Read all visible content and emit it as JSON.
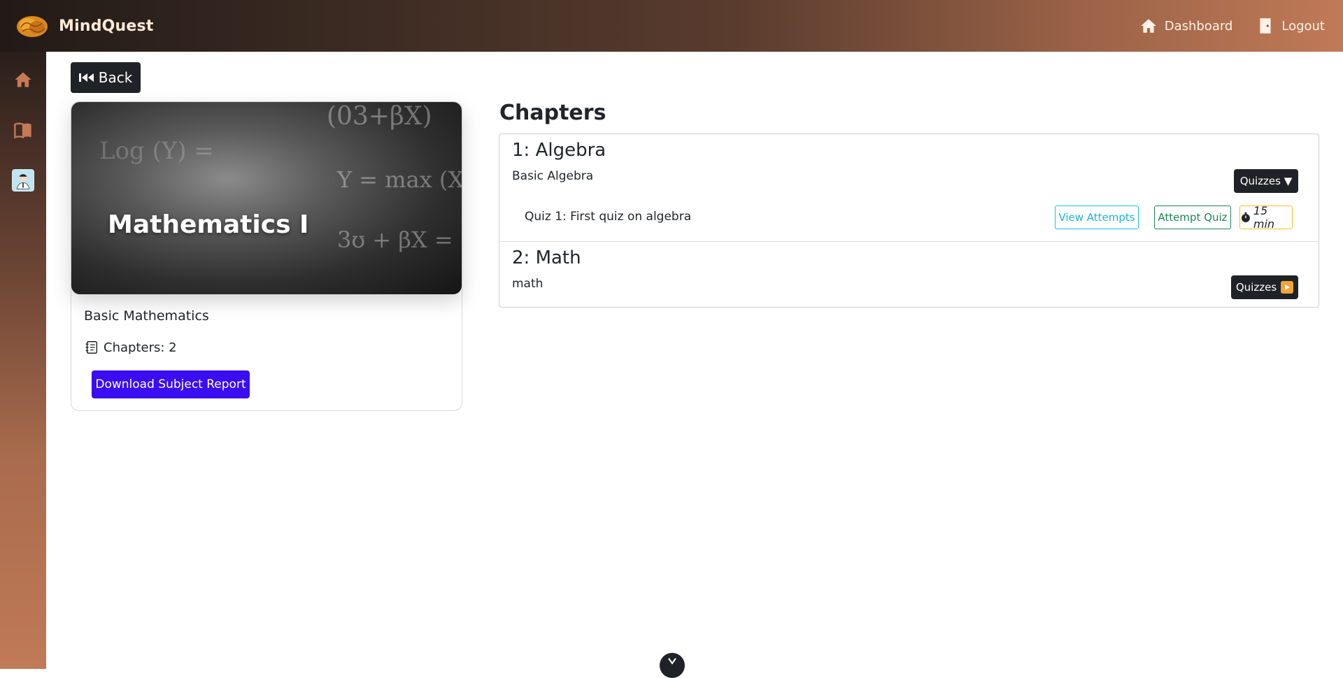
{
  "app": {
    "name": "MindQuest"
  },
  "topnav": {
    "dashboard_label": "Dashboard",
    "logout_label": "Logout"
  },
  "sidebar": {
    "items": [
      {
        "icon": "home-icon"
      },
      {
        "icon": "book-icon"
      },
      {
        "icon": "avatar"
      }
    ]
  },
  "back_label": "Back",
  "subject": {
    "image_title": "Mathematics I",
    "description": "Basic Mathematics",
    "chapters_label": "Chapters: 2",
    "download_label": "Download Subject Report"
  },
  "chapters": {
    "heading": "Chapters",
    "items": [
      {
        "title": "1: Algebra",
        "description": "Basic Algebra",
        "quizzes_label": "Quizzes ▼",
        "quizzes": [
          {
            "name": "Quiz 1: First quiz on algebra",
            "view_attempts_label": "View Attempts",
            "attempt_label": "Attempt Quiz",
            "duration": "15 min"
          }
        ]
      },
      {
        "title": "2: Math",
        "description": "math",
        "quizzes_label": "Quizzes"
      }
    ]
  },
  "colors": {
    "accent_purple": "#3a0df2",
    "dark_button": "#1f2328",
    "info": "#19c3e0",
    "success": "#1a8754",
    "warning": "#f5c02b"
  }
}
